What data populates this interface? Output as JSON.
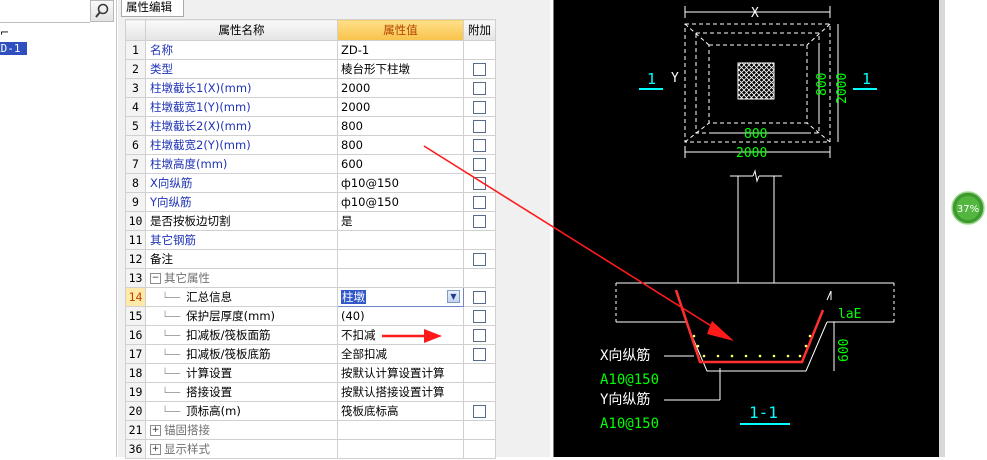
{
  "tree": {
    "selected_node": "ZD-1",
    "partial_glyph": "ZD-1"
  },
  "panel_tab": "属性编辑",
  "columns": {
    "num": "",
    "name": "属性名称",
    "value": "属性值",
    "extra": "附加"
  },
  "rows": [
    {
      "num": "1",
      "name": "名称",
      "value": "ZD-1",
      "style": "blue",
      "checkbox": false
    },
    {
      "num": "2",
      "name": "类型",
      "value": "棱台形下柱墩",
      "style": "blue",
      "checkbox": true
    },
    {
      "num": "3",
      "name": "柱墩截长1(X)(mm)",
      "value": "2000",
      "style": "blue",
      "checkbox": true
    },
    {
      "num": "4",
      "name": "柱墩截宽1(Y)(mm)",
      "value": "2000",
      "style": "blue",
      "checkbox": true
    },
    {
      "num": "5",
      "name": "柱墩截长2(X)(mm)",
      "value": "800",
      "style": "blue",
      "checkbox": true
    },
    {
      "num": "6",
      "name": "柱墩截宽2(Y)(mm)",
      "value": "800",
      "style": "blue",
      "checkbox": true
    },
    {
      "num": "7",
      "name": "柱墩高度(mm)",
      "value": "600",
      "style": "blue",
      "checkbox": true
    },
    {
      "num": "8",
      "name": "X向纵筋",
      "value": "ф10@150",
      "style": "blue",
      "checkbox": true
    },
    {
      "num": "9",
      "name": "Y向纵筋",
      "value": "ф10@150",
      "style": "blue",
      "checkbox": true
    },
    {
      "num": "10",
      "name": "是否按板边切割",
      "value": "是",
      "style": "black",
      "checkbox": true
    },
    {
      "num": "11",
      "name": "其它钢筋",
      "value": "",
      "style": "blue",
      "checkbox": false
    },
    {
      "num": "12",
      "name": "备注",
      "value": "",
      "style": "black",
      "checkbox": true
    },
    {
      "num": "13",
      "name": "其它属性",
      "value": "",
      "style": "group",
      "expander": "−",
      "checkbox": false
    },
    {
      "num": "14",
      "name": "汇总信息",
      "value": "柱墩",
      "style": "child",
      "current": true,
      "checkbox": true
    },
    {
      "num": "15",
      "name": "保护层厚度(mm)",
      "value": "(40)",
      "style": "child",
      "checkbox": true
    },
    {
      "num": "16",
      "name": "扣减板/筏板面筋",
      "value": "不扣减",
      "style": "child",
      "checkbox": true
    },
    {
      "num": "17",
      "name": "扣减板/筏板底筋",
      "value": "全部扣减",
      "style": "child",
      "checkbox": true
    },
    {
      "num": "18",
      "name": "计算设置",
      "value": "按默认计算设置计算",
      "style": "child",
      "checkbox": false
    },
    {
      "num": "19",
      "name": "搭接设置",
      "value": "按默认搭接设置计算",
      "style": "child",
      "checkbox": false
    },
    {
      "num": "20",
      "name": "顶标高(m)",
      "value": "筏板底标高",
      "style": "child",
      "checkbox": true
    },
    {
      "num": "21",
      "name": "锚固搭接",
      "value": "",
      "style": "group",
      "expander": "+",
      "checkbox": false
    },
    {
      "num": "36",
      "name": "显示样式",
      "value": "",
      "style": "group",
      "expander": "+",
      "checkbox": false
    }
  ],
  "drawing": {
    "dim_x": "X",
    "dim_y": "Y",
    "dim_800_h": "800",
    "dim_2000_h": "2000",
    "dim_800_v": "800",
    "dim_2000_v": "2000",
    "section_left": "1",
    "section_right": "1",
    "lae": "laE",
    "dim_600": "600",
    "x_rebar_label": "X向纵筋",
    "x_rebar_spec": "A10@150",
    "y_rebar_label": "Y向纵筋",
    "y_rebar_spec": "A10@150",
    "section_title": "1-1",
    "colors": {
      "bg": "#000000",
      "line": "#ffffff",
      "dim": "#00ff00",
      "label": "#00ffff",
      "rebar": "#ff3030"
    }
  },
  "progress": {
    "label": "37%",
    "value": 37
  }
}
